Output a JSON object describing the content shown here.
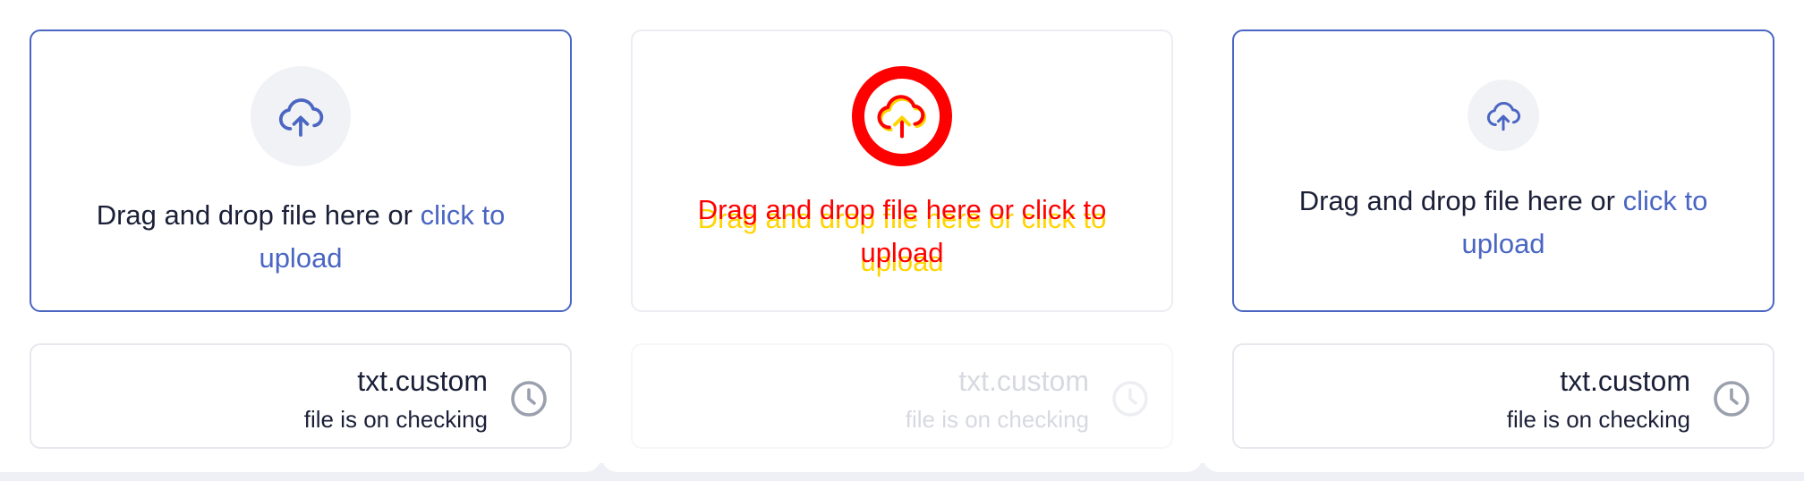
{
  "dropzone": {
    "text": "Drag and drop file here or ",
    "link": "click to upload"
  },
  "file": {
    "name": "txt.custom",
    "status": "file is on checking"
  },
  "colors": {
    "accent": "#4a66c2",
    "text": "#1b2038",
    "icon_bg": "#f1f2f5",
    "border": "#e6e8ee",
    "highlight_red": "#ff0000",
    "highlight_yellow": "#ffd400"
  },
  "icons": {
    "upload": "cloud-upload-icon",
    "status": "clock-icon"
  }
}
